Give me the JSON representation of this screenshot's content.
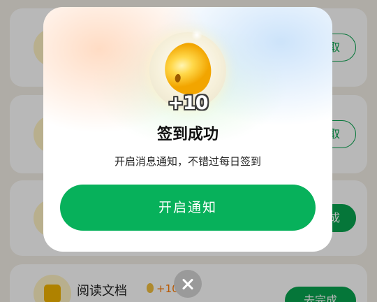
{
  "tasks": [
    {
      "button_label": "领取"
    },
    {
      "button_label": "领取"
    },
    {
      "button_label": "完成"
    },
    {
      "title": "阅读文档",
      "reward": "+10",
      "button_label": "去完成"
    }
  ],
  "dialog": {
    "reward_amount": "+10",
    "title": "签到成功",
    "subtitle": "开启消息通知，不错过每日签到",
    "primary_button": "开启通知",
    "close_icon": "close-icon"
  },
  "icons": {
    "reward": "bean-coin-icon",
    "task": "task-document-icon"
  },
  "colors": {
    "primary_green": "#07b15b",
    "task_button_green": "#07a44f",
    "reward_orange": "#ff7a00",
    "bean_gold": "#f2a500"
  }
}
